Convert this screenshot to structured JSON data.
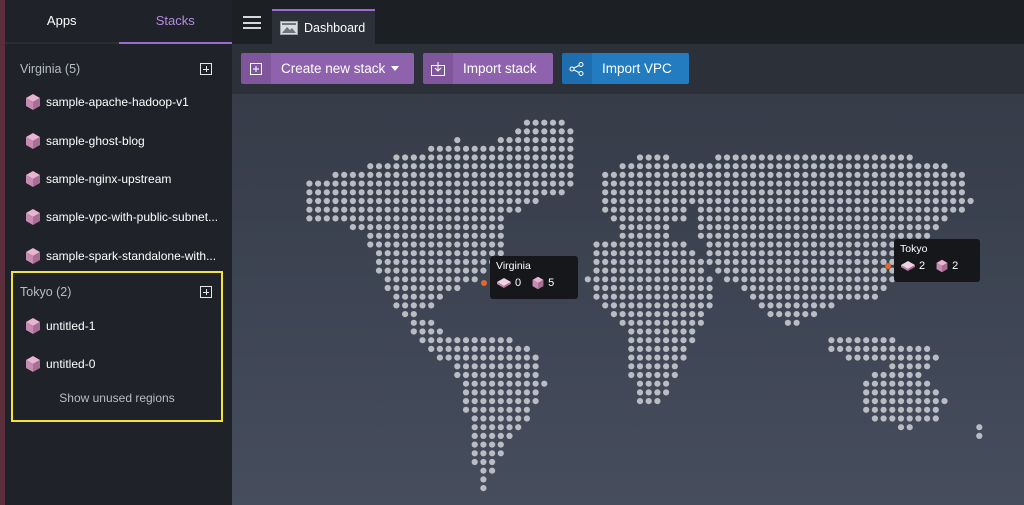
{
  "sidebar": {
    "tabs": [
      {
        "label": "Apps",
        "active": false
      },
      {
        "label": "Stacks",
        "active": true
      }
    ],
    "regions": [
      {
        "name": "Virginia (5)",
        "stacks": [
          "sample-apache-hadoop-v1",
          "sample-ghost-blog",
          "sample-nginx-upstream",
          "sample-vpc-with-public-subnet...",
          "sample-spark-standalone-with..."
        ]
      },
      {
        "name": "Tokyo (2)",
        "stacks": [
          "untitled-1",
          "untitled-0"
        ]
      }
    ],
    "show_unused": "Show unused regions"
  },
  "topbar": {
    "dashboard_tab": "Dashboard"
  },
  "toolbar": {
    "create_stack": "Create new stack",
    "import_stack": "Import stack",
    "import_vpc": "Import VPC"
  },
  "map": {
    "popups": [
      {
        "name": "Virginia",
        "apps": "0",
        "stacks": "5"
      },
      {
        "name": "Tokyo",
        "apps": "2",
        "stacks": "2"
      }
    ]
  },
  "colors": {
    "accent_purple": "#9b6bd1",
    "button_purple": "#8e62ad",
    "button_blue": "#237bc0",
    "highlight_yellow": "#f0e33a",
    "marker_orange": "#e06a2c"
  },
  "icons": {
    "stack": "cube-icon",
    "menu": "hamburger-icon",
    "dashboard": "dashboard-icon"
  }
}
